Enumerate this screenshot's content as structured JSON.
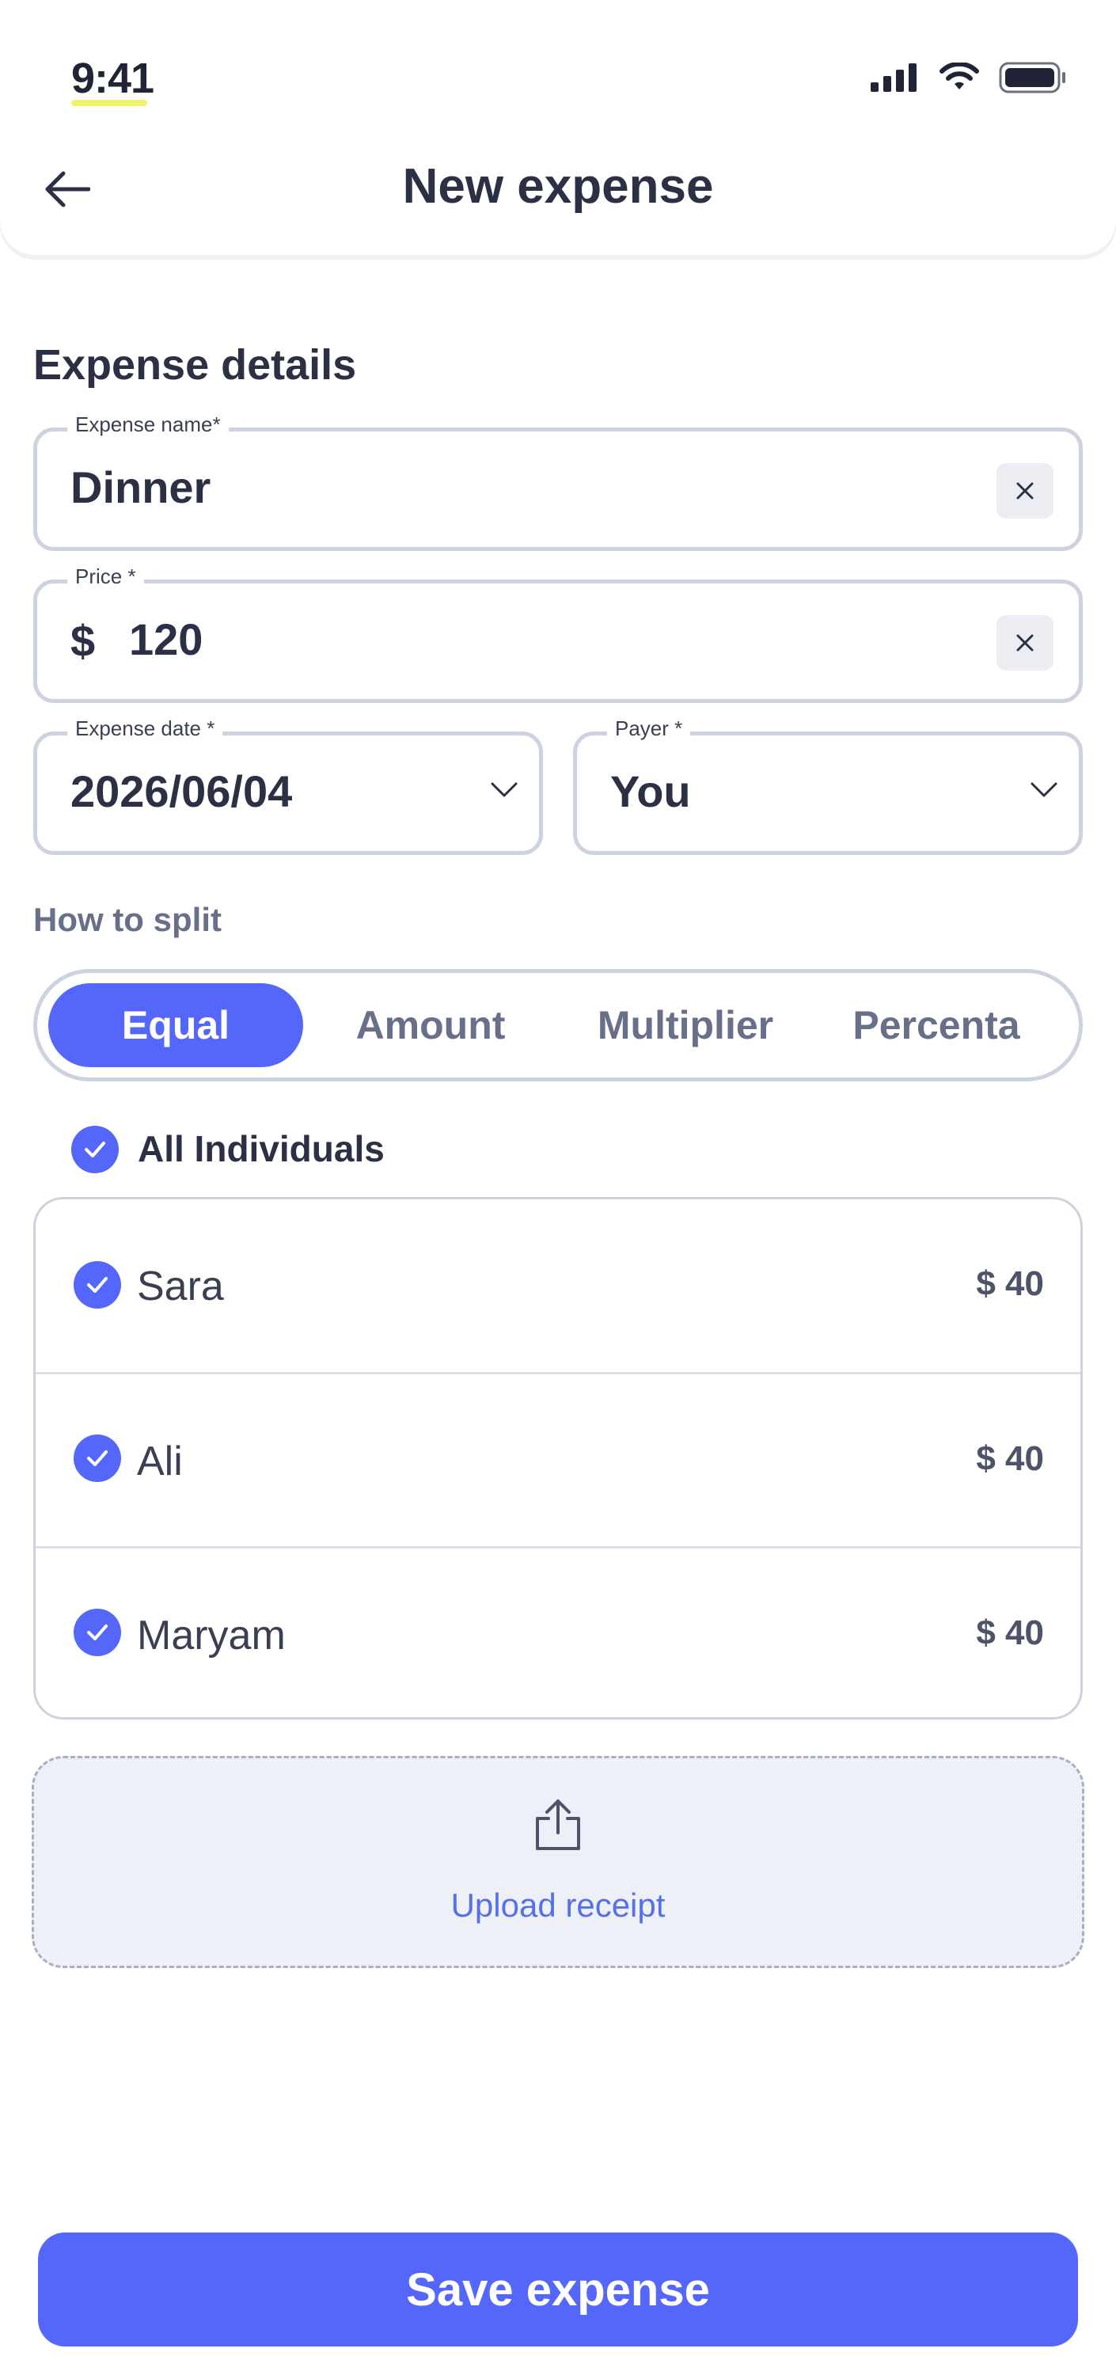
{
  "status_bar": {
    "time": "9:41"
  },
  "header": {
    "title": "New expense"
  },
  "section": {
    "title": "Expense details"
  },
  "fields": {
    "expense_name": {
      "label": "Expense name*",
      "value": "Dinner"
    },
    "price": {
      "label": "Price *",
      "currency": "$",
      "value": "120"
    },
    "expense_date": {
      "label": "Expense date *",
      "value": "2026/06/04"
    },
    "payer": {
      "label": "Payer *",
      "value": "You"
    }
  },
  "split": {
    "title": "How to split",
    "tabs": [
      {
        "label": "Equal",
        "active": true
      },
      {
        "label": "Amount",
        "active": false
      },
      {
        "label": "Multiplier",
        "active": false
      },
      {
        "label": "Percenta",
        "active": false
      }
    ]
  },
  "participants": {
    "all_label": "All Individuals",
    "items": [
      {
        "name": "Sara",
        "amount": "$ 40",
        "checked": true
      },
      {
        "name": "Ali",
        "amount": "$ 40",
        "checked": true
      },
      {
        "name": "Maryam",
        "amount": "$ 40",
        "checked": true
      }
    ]
  },
  "upload": {
    "label": "Upload receipt",
    "icon": "upload-icon"
  },
  "actions": {
    "save_label": "Save expense"
  },
  "colors": {
    "accent": "#5567fb",
    "text_dark": "#2b3044",
    "text_muted": "#687089",
    "border": "#cdd2e0",
    "upload_bg": "#eef0f8",
    "link": "#5570e8"
  }
}
